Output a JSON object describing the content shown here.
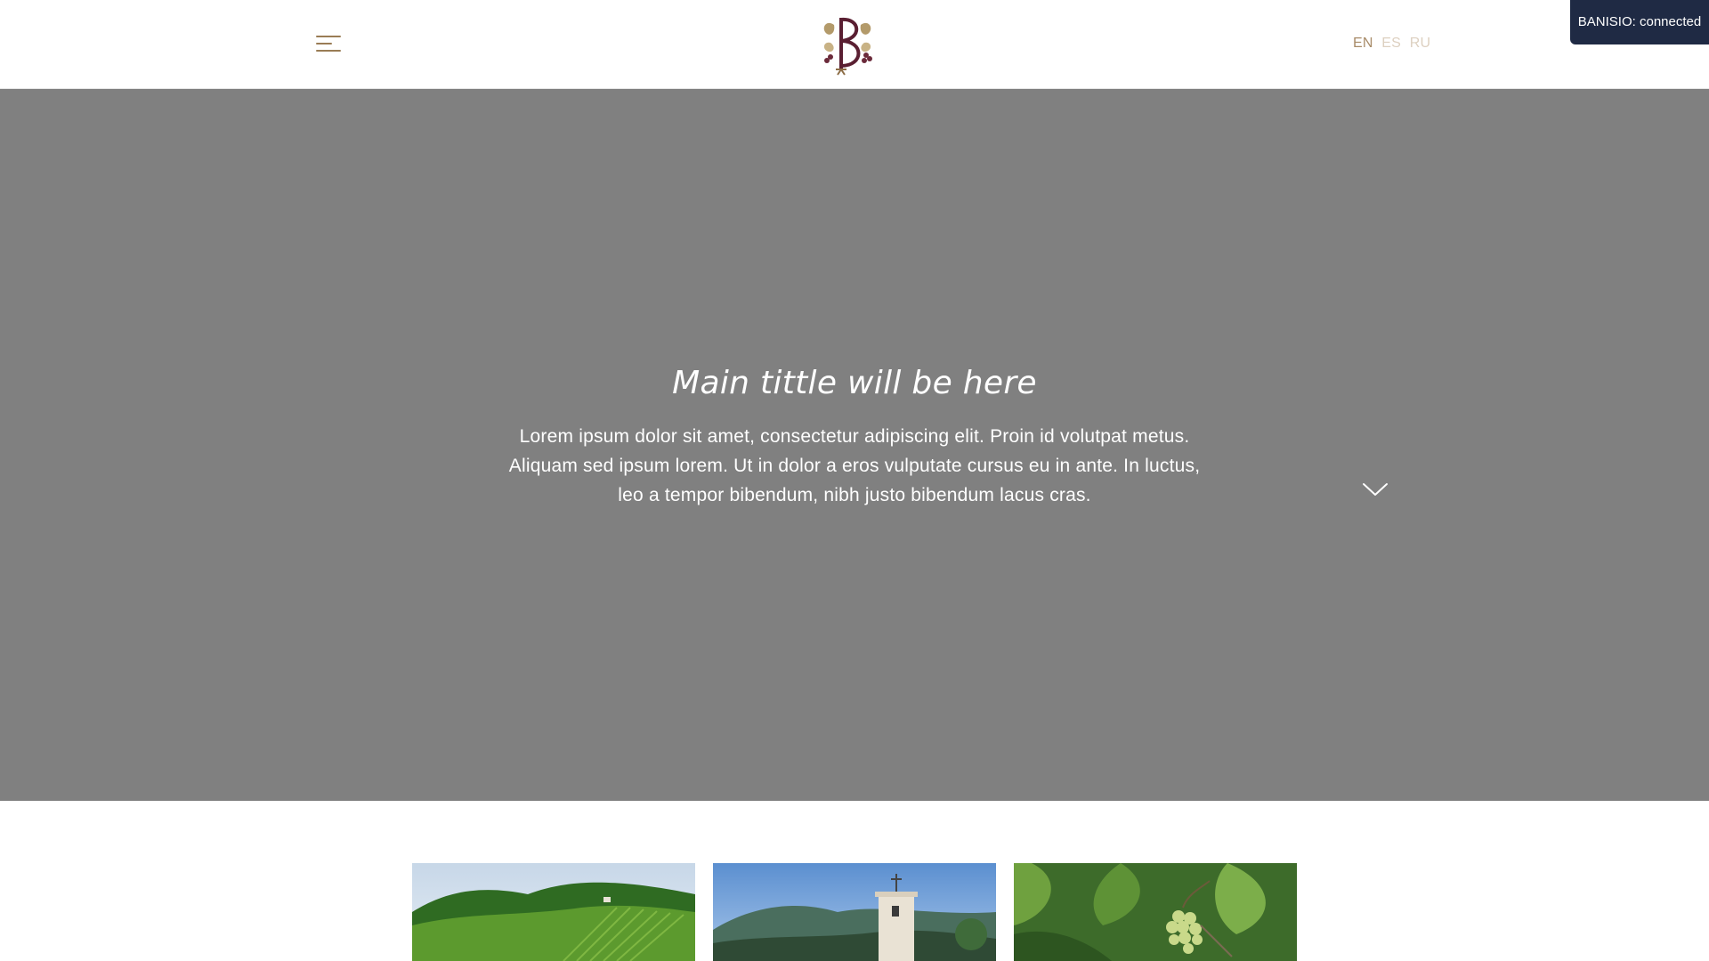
{
  "header": {
    "menu_icon": "hamburger-menu-icon",
    "logo_icon": "vineyard-monogram-logo",
    "languages": [
      {
        "code": "EN",
        "active": true
      },
      {
        "code": "ES",
        "active": false
      },
      {
        "code": "RU",
        "active": false
      }
    ]
  },
  "status_badge": {
    "label": "BANISIO: connected",
    "color": "#1f2a44"
  },
  "hero": {
    "title": "Main tittle will be here",
    "text": "Lorem ipsum dolor sit amet, consectetur adipiscing elit. Proin id volutpat metus. Aliquam sed ipsum lorem. Ut in dolor a eros vulputate cursus eu in ante. In luctus, leo a tempor bibendum, nibh justo bibendum lacus cras.",
    "background": "#808080",
    "scroll_icon": "chevron-down-icon"
  },
  "gallery": {
    "images": [
      {
        "name": "vineyard-hills-image"
      },
      {
        "name": "winery-tower-image"
      },
      {
        "name": "grapes-vine-image"
      }
    ]
  },
  "colors": {
    "accent": "#9a7c55",
    "lang_active": "#a88b68",
    "lang_inactive": "#ddd0c0"
  }
}
